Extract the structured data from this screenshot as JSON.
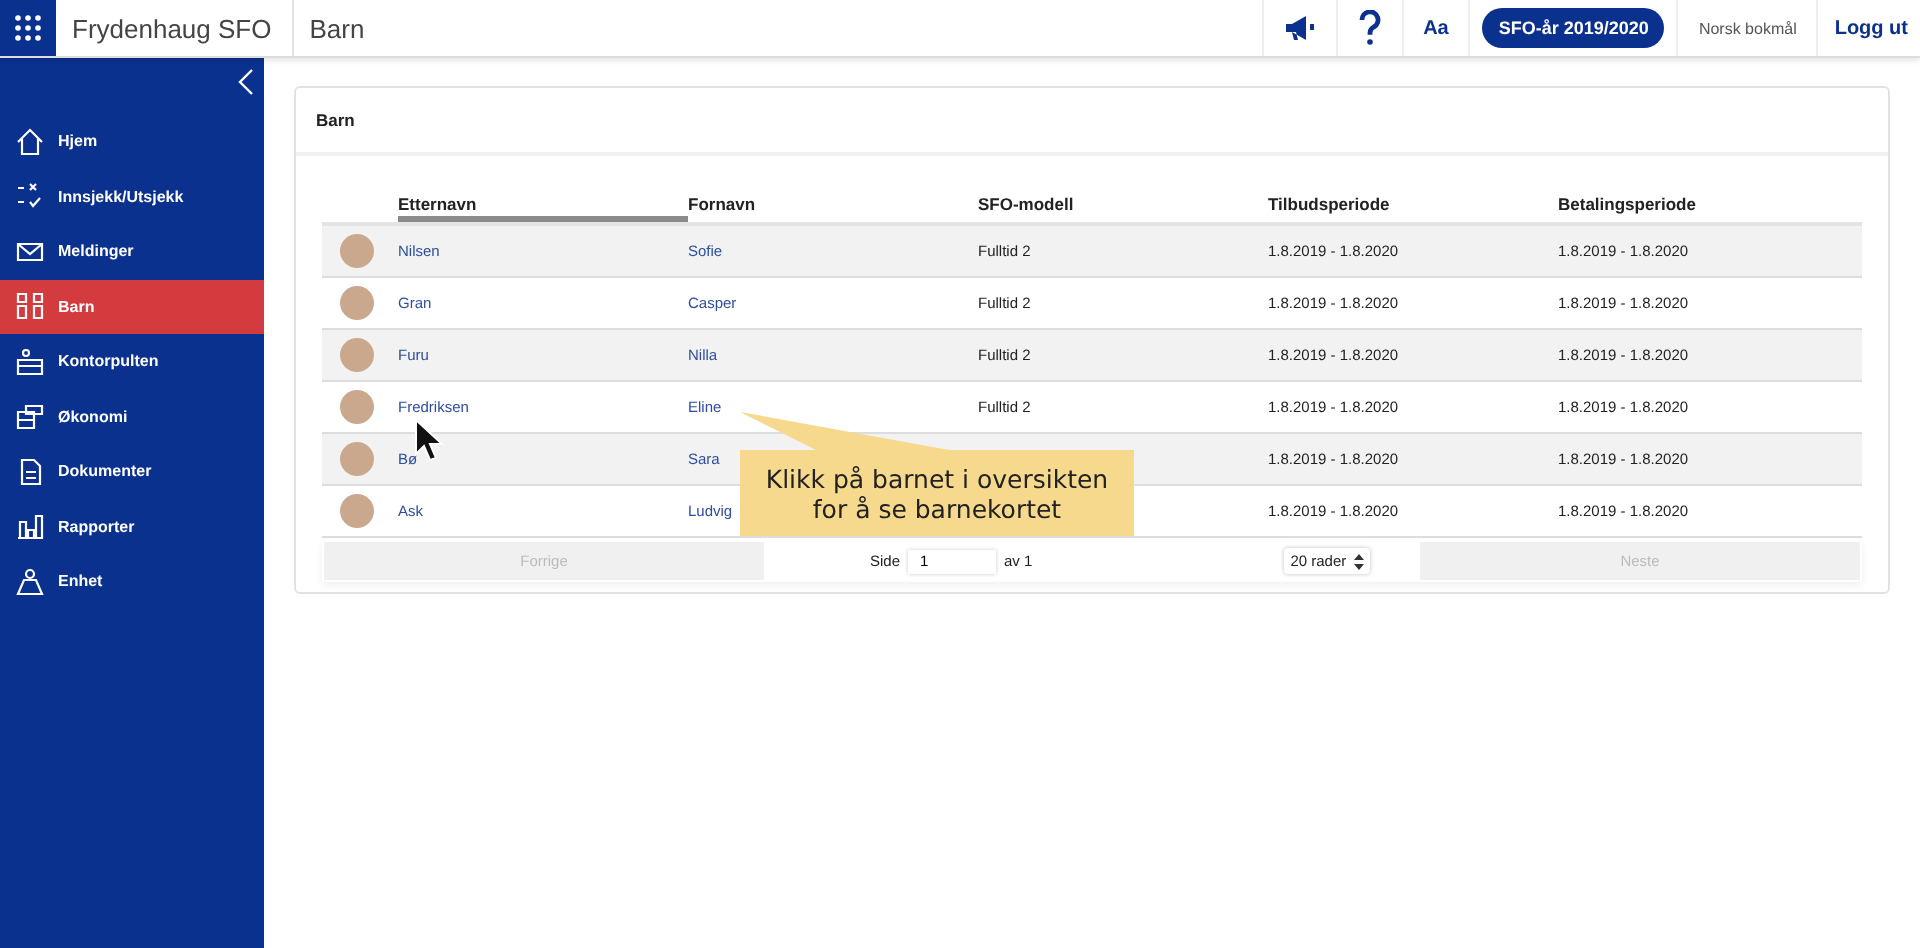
{
  "topbar": {
    "app_name": "Frydenhaug SFO",
    "page": "Barn",
    "text_size_button": "Aa",
    "year_button": "SFO-år 2019/2020",
    "language": "Norsk bokmål",
    "logout": "Logg ut"
  },
  "sidebar": {
    "items": [
      {
        "label": "Hjem",
        "selected": false
      },
      {
        "label": "Innsjekk/Utsjekk",
        "selected": false
      },
      {
        "label": "Meldinger",
        "selected": false
      },
      {
        "label": "Barn",
        "selected": true
      },
      {
        "label": "Kontorpulten",
        "selected": false
      },
      {
        "label": "Økonomi",
        "selected": false
      },
      {
        "label": "Dokumenter",
        "selected": false
      },
      {
        "label": "Rapporter",
        "selected": false
      },
      {
        "label": "Enhet",
        "selected": false
      }
    ]
  },
  "panel": {
    "title": "Barn"
  },
  "table": {
    "columns": [
      {
        "label": "Etternavn",
        "sorted": true
      },
      {
        "label": "Fornavn",
        "sorted": false
      },
      {
        "label": "SFO-modell",
        "sorted": false
      },
      {
        "label": "Tilbudsperiode",
        "sorted": false
      },
      {
        "label": "Betalingsperiode",
        "sorted": false
      }
    ],
    "rows": [
      {
        "last_name": "Nilsen",
        "first_name": "Sofie",
        "model": "Fulltid 2",
        "offer_period": "1.8.2019 - 1.8.2020",
        "payment_period": "1.8.2019 - 1.8.2020"
      },
      {
        "last_name": "Gran",
        "first_name": "Casper",
        "model": "Fulltid 2",
        "offer_period": "1.8.2019 - 1.8.2020",
        "payment_period": "1.8.2019 - 1.8.2020"
      },
      {
        "last_name": "Furu",
        "first_name": "Nilla",
        "model": "Fulltid 2",
        "offer_period": "1.8.2019 - 1.8.2020",
        "payment_period": "1.8.2019 - 1.8.2020"
      },
      {
        "last_name": "Fredriksen",
        "first_name": "Eline",
        "model": "Fulltid 2",
        "offer_period": "1.8.2019 - 1.8.2020",
        "payment_period": "1.8.2019 - 1.8.2020"
      },
      {
        "last_name": "Bø",
        "first_name": "Sara",
        "offer_period": "1.8.2019 - 1.8.2020",
        "payment_period": "1.8.2019 - 1.8.2020"
      },
      {
        "last_name": "Ask",
        "first_name": "Ludvig",
        "offer_period": "1.8.2019 - 1.8.2020",
        "payment_period": "1.8.2019 - 1.8.2020"
      }
    ]
  },
  "pagination": {
    "previous": {
      "label": "Forrige",
      "disabled": true
    },
    "page_label": "Side",
    "page": "1",
    "of": "av 1",
    "rows_per_page": "20 rader",
    "next": {
      "label": "Neste",
      "disabled": true
    }
  },
  "callout": {
    "text": "Klikk på barnet i oversikten for å se barnekortet"
  }
}
